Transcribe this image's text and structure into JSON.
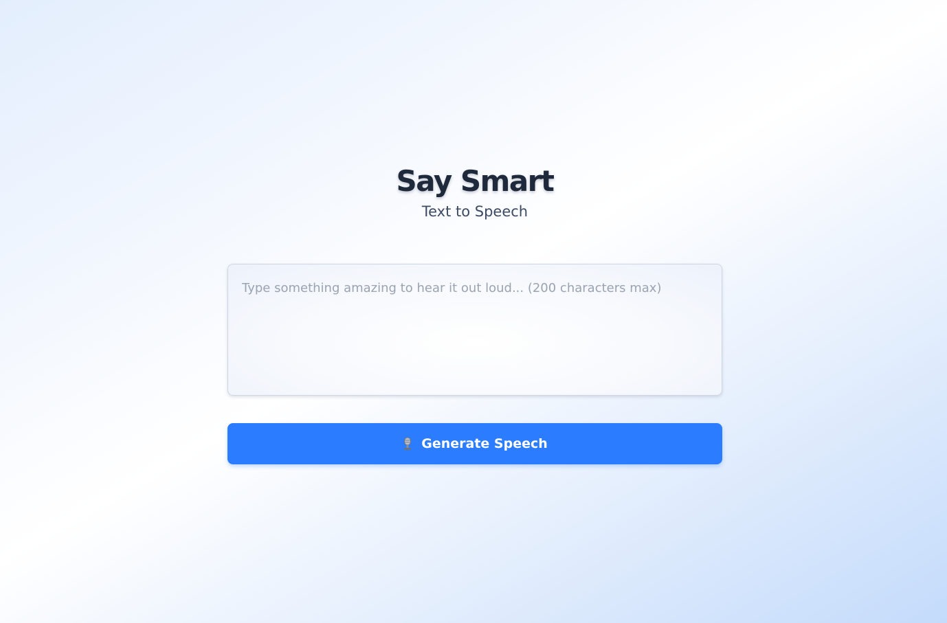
{
  "header": {
    "title": "Say Smart",
    "subtitle": "Text to Speech"
  },
  "input": {
    "value": "",
    "placeholder": "Type something amazing to hear it out loud... (200 characters max)"
  },
  "generate_button": {
    "icon": "microphone-icon",
    "label": "Generate Speech"
  },
  "colors": {
    "accent": "#2b7cfe",
    "title": "#1e293b",
    "subtitle": "#3c4a63",
    "placeholder": "#9aa3b1"
  }
}
